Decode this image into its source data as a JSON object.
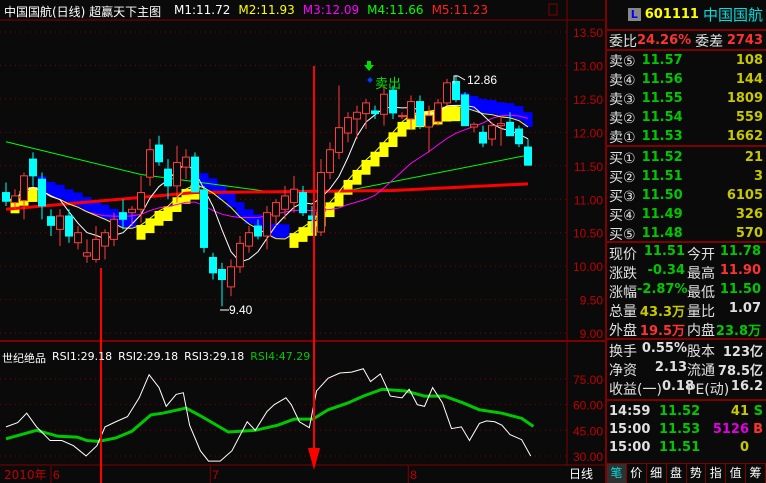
{
  "header": {
    "title": "中国国航(日线) 超赢天下主图",
    "ma": [
      {
        "label": "M1:11.72",
        "color": "#ffffff"
      },
      {
        "label": "M2:11.93",
        "color": "#ffff00"
      },
      {
        "label": "M3:12.09",
        "color": "#ff00ff"
      },
      {
        "label": "M4:11.66",
        "color": "#00ff00"
      },
      {
        "label": "M5:11.23",
        "color": "#ff2020"
      }
    ]
  },
  "indicator": {
    "name": "世纪绝品",
    "rsi1": "RSI1:29.18",
    "rsi2": "RSI2:29.18",
    "rsi3": "RSI3:29.18",
    "rsi4": "RSI4:47.29"
  },
  "annotations": {
    "high": "12.86",
    "low": "9.40",
    "signal": "卖出"
  },
  "date_axis": {
    "year": "2010年",
    "months": [
      {
        "label": "6",
        "day": 5
      },
      {
        "label": "7",
        "day": 22.7
      },
      {
        "label": "8",
        "day": 44.7
      }
    ],
    "period": "日线"
  },
  "chart_data": {
    "type": "candlestick",
    "price_axis": {
      "ticks": [
        "13.50",
        "13.00",
        "12.50",
        "12.00",
        "11.50",
        "11.00",
        "10.50",
        "10.00",
        "9.50",
        "9.00"
      ],
      "range": [
        9.0,
        13.5
      ]
    },
    "ohlc": [
      [
        11.1,
        11.25,
        10.9,
        10.97
      ],
      [
        10.95,
        11.15,
        10.85,
        11.05
      ],
      [
        10.98,
        11.4,
        10.7,
        11.35
      ],
      [
        11.6,
        11.7,
        11.2,
        11.35
      ],
      [
        11.3,
        11.4,
        10.7,
        10.9
      ],
      [
        10.74,
        10.85,
        10.45,
        10.61
      ],
      [
        10.55,
        10.85,
        10.3,
        10.75
      ],
      [
        10.75,
        10.85,
        10.35,
        10.45
      ],
      [
        10.35,
        10.6,
        10.25,
        10.5
      ],
      [
        10.15,
        10.4,
        10.05,
        10.2
      ],
      [
        10.1,
        10.6,
        10.05,
        10.4
      ],
      [
        10.3,
        10.55,
        10.1,
        10.5
      ],
      [
        10.4,
        10.8,
        10.3,
        10.7
      ],
      [
        10.8,
        11.0,
        10.55,
        10.7
      ],
      [
        10.8,
        10.9,
        10.6,
        10.85
      ],
      [
        10.85,
        11.35,
        10.65,
        11.1
      ],
      [
        11.33,
        11.9,
        11.2,
        11.74
      ],
      [
        11.81,
        11.95,
        11.5,
        11.56
      ],
      [
        11.45,
        11.6,
        11.0,
        11.2
      ],
      [
        11.2,
        11.8,
        10.95,
        11.55
      ],
      [
        11.48,
        11.75,
        11.3,
        11.63
      ],
      [
        11.63,
        11.7,
        11.1,
        11.11
      ],
      [
        11.14,
        11.2,
        10.2,
        10.28
      ],
      [
        10.13,
        10.2,
        9.8,
        9.9
      ],
      [
        9.95,
        10.05,
        9.4,
        9.8
      ],
      [
        9.69,
        10.1,
        9.55,
        9.99
      ],
      [
        9.99,
        10.45,
        9.9,
        10.34
      ],
      [
        10.3,
        10.6,
        10.2,
        10.5
      ],
      [
        10.6,
        10.7,
        10.4,
        10.45
      ],
      [
        10.45,
        10.9,
        10.25,
        10.8
      ],
      [
        10.75,
        11.0,
        10.6,
        10.95
      ],
      [
        10.85,
        11.2,
        10.7,
        11.05
      ],
      [
        10.95,
        11.35,
        10.8,
        11.15
      ],
      [
        11.1,
        11.2,
        10.75,
        10.8
      ],
      [
        10.75,
        10.9,
        10.5,
        10.7
      ],
      [
        10.51,
        11.6,
        10.45,
        11.4
      ],
      [
        11.4,
        11.85,
        11.3,
        11.74
      ],
      [
        11.7,
        12.7,
        11.6,
        12.07
      ],
      [
        11.99,
        12.3,
        11.85,
        12.22
      ],
      [
        12.2,
        12.4,
        11.9,
        12.3
      ],
      [
        12.28,
        12.5,
        12.05,
        12.44
      ],
      [
        12.32,
        12.4,
        12.2,
        12.28
      ],
      [
        12.27,
        12.7,
        12.1,
        12.57
      ],
      [
        12.63,
        12.7,
        12.2,
        12.29
      ],
      [
        12.24,
        12.3,
        12.2,
        12.25
      ],
      [
        12.2,
        12.55,
        12.05,
        12.46
      ],
      [
        12.46,
        12.55,
        12.05,
        12.1
      ],
      [
        12.08,
        12.4,
        11.7,
        12.25
      ],
      [
        12.16,
        12.5,
        12.1,
        12.44
      ],
      [
        12.44,
        12.8,
        12.4,
        12.74
      ],
      [
        12.76,
        12.86,
        12.45,
        12.49
      ],
      [
        12.56,
        12.6,
        12.1,
        12.1
      ],
      [
        12.08,
        12.15,
        12.0,
        12.12
      ],
      [
        12.0,
        12.1,
        11.78,
        11.84
      ],
      [
        11.9,
        12.15,
        11.8,
        12.1
      ],
      [
        12.1,
        12.25,
        11.8,
        12.13
      ],
      [
        12.15,
        12.3,
        11.95,
        11.95
      ],
      [
        12.05,
        12.1,
        11.78,
        11.83
      ],
      [
        11.78,
        11.9,
        11.5,
        11.51
      ]
    ],
    "ma4": [
      [
        0,
        11.86
      ],
      [
        15,
        11.37
      ],
      [
        30,
        11.1
      ],
      [
        38,
        11.13
      ],
      [
        58,
        11.66
      ]
    ],
    "ma5": [
      [
        0,
        10.85
      ],
      [
        21,
        11.1
      ],
      [
        43,
        11.13
      ],
      [
        58,
        11.23
      ]
    ],
    "rsi_axis": {
      "ticks": [
        "75.00",
        "60.00",
        "45.00",
        "30.00"
      ],
      "range": [
        30,
        75
      ]
    },
    "rsi_white": [
      [
        0,
        47
      ],
      [
        1.3,
        49.5
      ],
      [
        2.3,
        55
      ],
      [
        3.4,
        47
      ],
      [
        4.9,
        39
      ],
      [
        6.2,
        39
      ],
      [
        7.5,
        36
      ],
      [
        8.9,
        30
      ],
      [
        10.1,
        36
      ],
      [
        11,
        47
      ],
      [
        12.2,
        50
      ],
      [
        13.5,
        53
      ],
      [
        14.8,
        64
      ],
      [
        15.9,
        77.5
      ],
      [
        17,
        70
      ],
      [
        17.8,
        59
      ],
      [
        18.9,
        66
      ],
      [
        19.7,
        67
      ],
      [
        20.4,
        48
      ],
      [
        21.6,
        33
      ],
      [
        22.5,
        27
      ],
      [
        23.8,
        27
      ],
      [
        25.1,
        33
      ],
      [
        26.8,
        50
      ],
      [
        27.7,
        45
      ],
      [
        29,
        56
      ],
      [
        29.8,
        60
      ],
      [
        31.1,
        64
      ],
      [
        31.7,
        60
      ],
      [
        32.6,
        50
      ],
      [
        33.7,
        46.5
      ],
      [
        34.5,
        68
      ],
      [
        35.8,
        75.5
      ],
      [
        37.1,
        78.5
      ],
      [
        38.4,
        79
      ],
      [
        39.7,
        81
      ],
      [
        40.5,
        73.5
      ],
      [
        41.6,
        78
      ],
      [
        42.3,
        70
      ],
      [
        42.7,
        65
      ],
      [
        44,
        64
      ],
      [
        44.8,
        69
      ],
      [
        45.7,
        60
      ],
      [
        46.5,
        59
      ],
      [
        47.4,
        70
      ],
      [
        48.5,
        61
      ],
      [
        49.5,
        46
      ],
      [
        50.6,
        47
      ],
      [
        51.5,
        39
      ],
      [
        52.6,
        49
      ],
      [
        53.4,
        50.5
      ],
      [
        54.3,
        50
      ],
      [
        55.1,
        48
      ],
      [
        56,
        42.5
      ],
      [
        57.3,
        39.5
      ],
      [
        58.3,
        30
      ]
    ],
    "rsi_green": [
      [
        0,
        40
      ],
      [
        3.4,
        45
      ],
      [
        5.8,
        41.5
      ],
      [
        7.9,
        41
      ],
      [
        9,
        39
      ],
      [
        10.3,
        38.5
      ],
      [
        12.2,
        40.5
      ],
      [
        14,
        44.5
      ],
      [
        16.1,
        54
      ],
      [
        17.4,
        55
      ],
      [
        20,
        58
      ],
      [
        21.6,
        53.5
      ],
      [
        24.7,
        44
      ],
      [
        27.7,
        45
      ],
      [
        30.2,
        48
      ],
      [
        32,
        51.5
      ],
      [
        34.1,
        51.5
      ],
      [
        35.8,
        57
      ],
      [
        38,
        61
      ],
      [
        39.7,
        65
      ],
      [
        41.8,
        69
      ],
      [
        44.4,
        68
      ],
      [
        46.5,
        65
      ],
      [
        48.7,
        65
      ],
      [
        50.8,
        61
      ],
      [
        52.6,
        57
      ],
      [
        55.1,
        55
      ],
      [
        57.3,
        52
      ],
      [
        58.6,
        47.3
      ]
    ]
  },
  "quote": {
    "badge": "L",
    "code": "601111",
    "name": "中国国航",
    "wb_label": "委比",
    "wb": "24.26%",
    "wc_label": "委差",
    "wc": "2743",
    "asks": [
      {
        "label": "卖⑤",
        "price": "11.57",
        "vol": "108"
      },
      {
        "label": "卖④",
        "price": "11.56",
        "vol": "144"
      },
      {
        "label": "卖③",
        "price": "11.55",
        "vol": "1809"
      },
      {
        "label": "卖②",
        "price": "11.54",
        "vol": "559"
      },
      {
        "label": "卖①",
        "price": "11.53",
        "vol": "1662"
      }
    ],
    "bids": [
      {
        "label": "买①",
        "price": "11.52",
        "vol": "21"
      },
      {
        "label": "买②",
        "price": "11.51",
        "vol": "3"
      },
      {
        "label": "买③",
        "price": "11.50",
        "vol": "6105"
      },
      {
        "label": "买④",
        "price": "11.49",
        "vol": "326"
      },
      {
        "label": "买⑤",
        "price": "11.48",
        "vol": "570"
      }
    ],
    "stats": [
      [
        {
          "l": "现价",
          "v": "11.51",
          "c": "g"
        },
        {
          "l": "今开",
          "v": "11.78",
          "c": "g"
        }
      ],
      [
        {
          "l": "涨跌",
          "v": "-0.34",
          "c": "g"
        },
        {
          "l": "最高",
          "v": "11.90",
          "c": "r"
        }
      ],
      [
        {
          "l": "涨幅",
          "v": "-2.87%",
          "c": "g"
        },
        {
          "l": "最低",
          "v": "11.50",
          "c": "g"
        }
      ],
      [
        {
          "l": "总量",
          "v": "43.3万",
          "c": "y"
        },
        {
          "l": "量比",
          "v": "1.07",
          "c": "w"
        }
      ],
      [
        {
          "l": "外盘",
          "v": "19.5万",
          "c": "r"
        },
        {
          "l": "内盘",
          "v": "23.8万",
          "c": "g"
        }
      ]
    ],
    "fund": [
      [
        {
          "l": "换手",
          "v": "0.55%"
        },
        {
          "l": "股本",
          "v": "123亿"
        }
      ],
      [
        {
          "l": "净资",
          "v": "2.13"
        },
        {
          "l": "流通",
          "v": "78.5亿"
        }
      ],
      [
        {
          "l": "收益(一)",
          "v": "0.18"
        },
        {
          "l": "PE(动)",
          "v": "16.2"
        }
      ]
    ],
    "trades": [
      {
        "t": "14:59",
        "p": "11.52",
        "v": "41",
        "f": "S",
        "vc": "y",
        "fc": "g"
      },
      {
        "t": "15:00",
        "p": "11.53",
        "v": "5126",
        "f": "B",
        "vc": "m",
        "fc": "r"
      },
      {
        "t": "15:00",
        "p": "11.51",
        "v": "0",
        "f": "",
        "vc": "y",
        "fc": "g"
      }
    ],
    "tabs": [
      "笔",
      "价",
      "细",
      "盘",
      "势",
      "指",
      "值",
      "筹"
    ]
  }
}
